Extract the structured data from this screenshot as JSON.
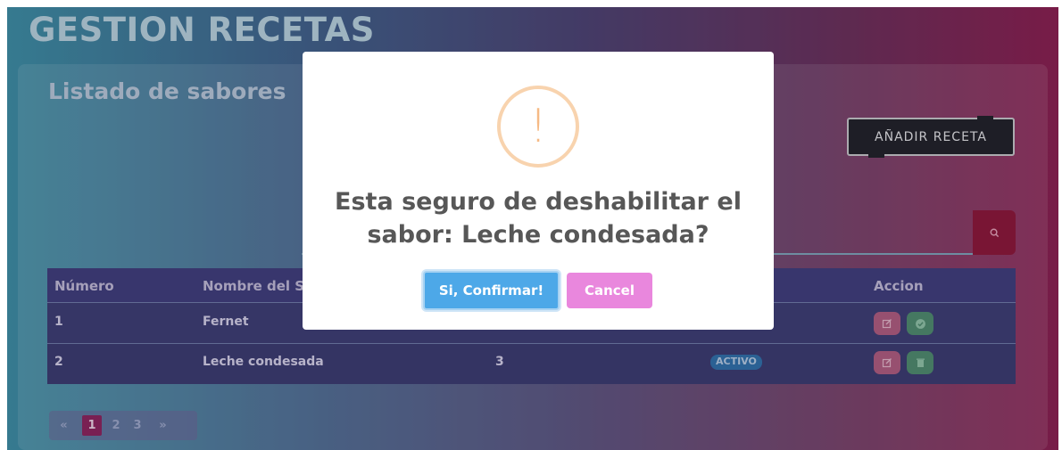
{
  "page": {
    "title": "GESTION RECETAS",
    "card_title": "Listado de sabores",
    "add_button": "AÑADIR RECETA",
    "search": {
      "placeholder": "",
      "value": ""
    }
  },
  "table": {
    "headers": [
      "Número",
      "Nombre del S",
      "",
      "",
      "Accion"
    ],
    "rows": [
      {
        "numero": "1",
        "nombre": "Fernet",
        "cantidad": "",
        "estado": ""
      },
      {
        "numero": "2",
        "nombre": "Leche condesada",
        "cantidad": "3",
        "estado": "ACTIVO"
      }
    ]
  },
  "pagination": {
    "prev": "«",
    "pages": [
      "1",
      "2",
      "3"
    ],
    "next": "»",
    "current": "1"
  },
  "modal": {
    "icon": "warning-icon",
    "message": "Esta seguro de deshabilitar el sabor: Leche condesada?",
    "confirm_label": "Si, Confirmar!",
    "cancel_label": "Cancel"
  },
  "colors": {
    "confirm": "#4da8e8",
    "cancel": "#e987dd",
    "warning": "#f6ba85",
    "search_button": "#8c1232",
    "active_badge": "#2d6ea8",
    "active_page": "#8c1f58"
  }
}
